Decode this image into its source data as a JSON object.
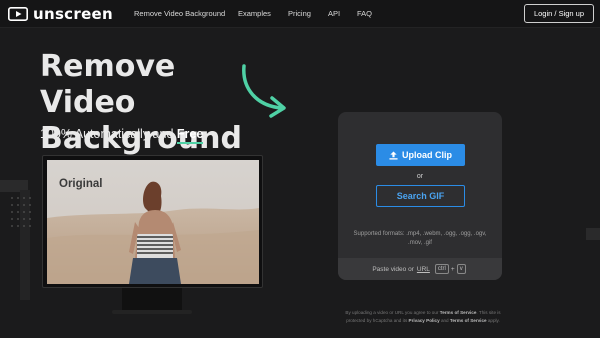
{
  "brand": {
    "name": "unscreen"
  },
  "nav": {
    "links": [
      "Remove Video Background",
      "Examples",
      "Pricing",
      "API",
      "FAQ"
    ],
    "login_label": "Login / Sign up"
  },
  "hero": {
    "title": "Remove Video Background",
    "subtitle_prefix": "100% Automatically and ",
    "subtitle_highlight": "Free"
  },
  "preview": {
    "label": "Original"
  },
  "upload": {
    "upload_label": "Upload Clip",
    "or_text": "or",
    "gif_label": "Search GIF",
    "formats_text": "Supported formats: .mp4, .webm, .ogg, .ogg, .ogv, .mov, .gif",
    "paste_prefix": "Paste video or",
    "paste_url": "URL",
    "key_ctrl": "ctrl",
    "key_plus": "+",
    "key_v": "v"
  },
  "legal": {
    "line1_prefix": "By uploading a video or URL you agree to our ",
    "terms_label": "Terms of Service",
    "line1_suffix": ". This site is",
    "line2_prefix": "protected by hCaptcha and its ",
    "privacy_label": "Privacy Policy",
    "and_text": " and ",
    "terms2_label": "Terms of Service",
    "line2_suffix": " apply."
  },
  "colors": {
    "accent_blue": "#2b8ce6",
    "accent_green": "#4fd1a5",
    "background": "#1b1b1c"
  },
  "icons": [
    "play-logo-icon",
    "curved-arrow-icon",
    "upload-icon"
  ]
}
